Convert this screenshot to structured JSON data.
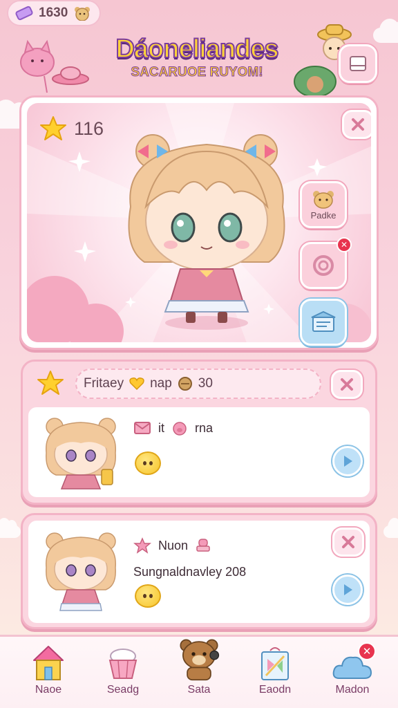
{
  "currency": {
    "amount": "1630",
    "icon": "gem-icon"
  },
  "logo": {
    "title": "Dáoneliandes",
    "subtitle": "SACARUOE RUYOM!"
  },
  "main_panel": {
    "score": "116",
    "side_buttons": [
      {
        "label": "Padke",
        "icon": "bear-face-icon"
      },
      {
        "label": "",
        "icon": "ring-icon"
      },
      {
        "label": "",
        "icon": "store-icon"
      }
    ]
  },
  "cards": [
    {
      "header": {
        "title": "Fritaey",
        "item": "nap",
        "count": "30"
      },
      "line1": {
        "a": "it",
        "b": "rna"
      }
    },
    {
      "header": null,
      "line1": {
        "a": "Nuon"
      },
      "line2": "Sungnaldnavley 208"
    }
  ],
  "bottom_nav": [
    {
      "label": "Naoe",
      "icon": "house-icon"
    },
    {
      "label": "Seadg",
      "icon": "cupcake-icon"
    },
    {
      "label": "Sata",
      "icon": "bear-mascot-icon"
    },
    {
      "label": "Eaodn",
      "icon": "gift-bag-icon"
    },
    {
      "label": "Madon",
      "icon": "cloud-icon",
      "badge": "✕"
    }
  ],
  "colors": {
    "accent": "#f3b3c6",
    "blue": "#8cc3e6",
    "badge": "#e8344f"
  }
}
